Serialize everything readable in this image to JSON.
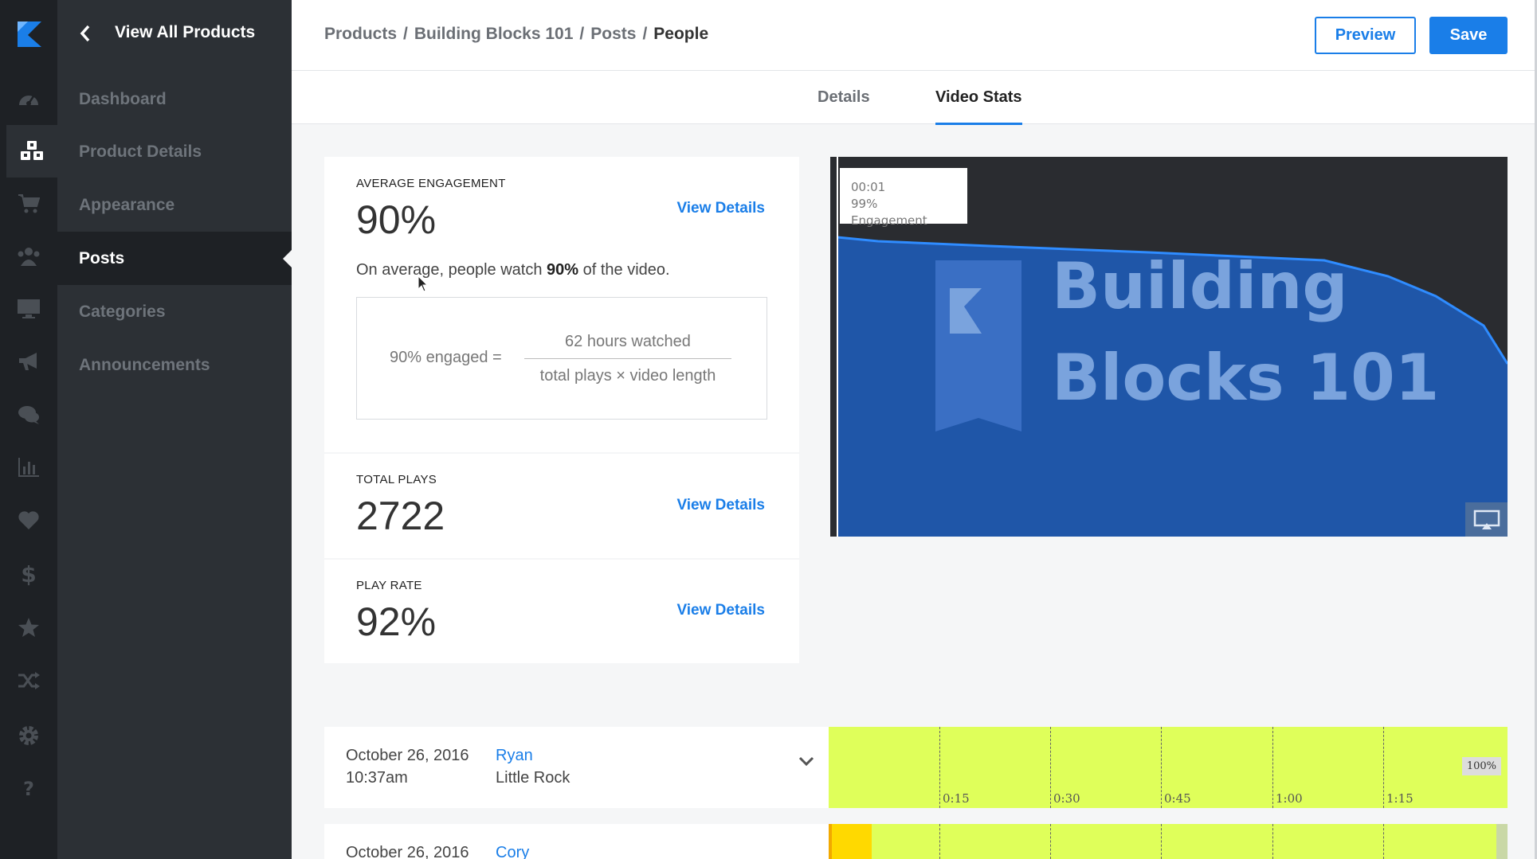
{
  "nav": {
    "back_label": "View All Products",
    "items": [
      {
        "label": "Dashboard"
      },
      {
        "label": "Product Details"
      },
      {
        "label": "Appearance"
      },
      {
        "label": "Posts"
      },
      {
        "label": "Categories"
      },
      {
        "label": "Announcements"
      }
    ],
    "active_item": "Posts"
  },
  "rail": {
    "icons": [
      "dashboard-icon",
      "products-icon",
      "cart-icon",
      "people-icon",
      "monitor-icon",
      "megaphone-icon",
      "chat-icon",
      "analytics-icon",
      "heart-icon",
      "dollar-icon",
      "star-icon",
      "shuffle-icon",
      "gear-icon",
      "help-icon"
    ],
    "active_icon": "products-icon"
  },
  "header": {
    "breadcrumbs": [
      "Products",
      "Building Blocks 101",
      "Posts",
      "People"
    ],
    "separator": "/",
    "preview_label": "Preview",
    "save_label": "Save"
  },
  "tabs": [
    {
      "label": "Details"
    },
    {
      "label": "Video Stats"
    }
  ],
  "active_tab": "Video Stats",
  "stats": {
    "engagement": {
      "title": "AVERAGE ENGAGEMENT",
      "value": "90%",
      "link": "View Details",
      "desc_prefix": "On average, people watch ",
      "desc_value": "90%",
      "desc_suffix": " of the video.",
      "formula_lhs": "90% engaged =",
      "formula_numerator": "62 hours watched",
      "formula_denominator": "total plays × video length"
    },
    "plays": {
      "title": "TOTAL PLAYS",
      "value": "2722",
      "link": "View Details"
    },
    "play_rate": {
      "title": "PLAY RATE",
      "value": "92%",
      "link": "View Details"
    }
  },
  "video": {
    "title_line1": "Building",
    "title_line2": "Blocks 101",
    "tooltip_time": "00:01",
    "tooltip_engagement": "99% Engagement"
  },
  "viewers": [
    {
      "date": "October 26, 2016",
      "time": "10:37am",
      "name": "Ryan",
      "location": "Little Rock",
      "watched_percent": "100%"
    },
    {
      "date": "October 26, 2016",
      "name": "Cory"
    }
  ],
  "timeline": {
    "ticks": [
      "0:15",
      "0:30",
      "0:45",
      "1:00",
      "1:15"
    ]
  },
  "colors": {
    "accent": "#1a7ee8",
    "sidebar_dark": "#1e2125",
    "sidebar": "#2c3035",
    "timeline": "#dfff5a",
    "timeline_highlight": "#ffd900"
  }
}
